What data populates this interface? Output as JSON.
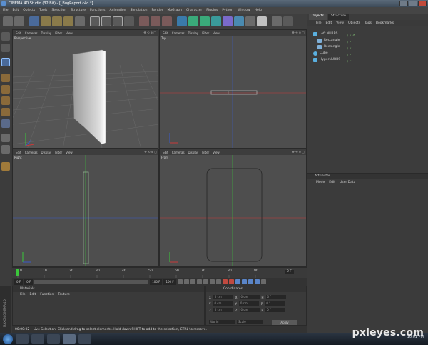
{
  "window": {
    "title": "CINEMA 4D Studio (32 Bit) - [_BugReport.c4d *]"
  },
  "menubar": {
    "items": [
      "File",
      "Edit",
      "Objects",
      "Tools",
      "Selection",
      "Structure",
      "Functions",
      "Animation",
      "Simulation",
      "Render",
      "MoGraph",
      "Character",
      "Plugins",
      "Python",
      "Window",
      "Help"
    ]
  },
  "viewport_menu": {
    "items": [
      "Edit",
      "Cameras",
      "Display",
      "Filter",
      "View"
    ]
  },
  "viewports": {
    "perspective": {
      "label": "Perspective"
    },
    "top": {
      "label": "Top"
    },
    "right": {
      "label": "Right"
    },
    "front": {
      "label": "Front"
    }
  },
  "object_manager": {
    "tabs": [
      "Objects",
      "Structure"
    ],
    "menu": [
      "File",
      "Edit",
      "View",
      "Objects",
      "Tags",
      "Bookmarks"
    ],
    "tree": [
      {
        "name": "Loft NURBS",
        "depth": 0,
        "icon": "loft-icon",
        "color": "#5ab0e0"
      },
      {
        "name": "Rectangle",
        "depth": 1,
        "icon": "spline-icon",
        "color": "#7fb0d8"
      },
      {
        "name": "Rectangle",
        "depth": 1,
        "icon": "spline-icon",
        "color": "#7fb0d8"
      },
      {
        "name": "Cube",
        "depth": 0,
        "icon": "cube-icon",
        "color": "#5ab0e0"
      },
      {
        "name": "HyperNURBS",
        "depth": 0,
        "icon": "hypernurbs-icon",
        "color": "#5ab0e0"
      }
    ]
  },
  "attribute_manager": {
    "title": "Attributes",
    "menu": [
      "Mode",
      "Edit",
      "User Data"
    ]
  },
  "timeline": {
    "ticks": [
      "0",
      "10",
      "20",
      "30",
      "40",
      "50",
      "60",
      "70",
      "80",
      "90"
    ],
    "end_label": "0 F"
  },
  "transport": {
    "start_field": "0 F",
    "current_field": "0 F",
    "end_field": "100 F",
    "end_field2": "100 F"
  },
  "materials": {
    "title": "Materials",
    "menu": [
      "File",
      "Edit",
      "Function",
      "Texture"
    ]
  },
  "coordinates": {
    "title": "Coordinates",
    "rows": [
      {
        "axis": "X",
        "pos": "0 cm",
        "size_axis": "X",
        "size": "0 cm",
        "rot_axis": "H",
        "rot": "0 °"
      },
      {
        "axis": "Y",
        "pos": "0 cm",
        "size_axis": "Y",
        "size": "0 cm",
        "rot_axis": "P",
        "rot": "0 °"
      },
      {
        "axis": "Z",
        "pos": "0 cm",
        "size_axis": "Z",
        "size": "0 cm",
        "rot_axis": "B",
        "rot": "0 °"
      }
    ],
    "mode1": "World",
    "mode2": "Scale",
    "apply": "Apply"
  },
  "status": {
    "time": "00:00:02",
    "message": "Live Selection: Click and drag to select elements. Hold down SHIFT to add to the selection, CTRL to remove."
  },
  "brand": "MAXON CINEMA 4D",
  "watermark": {
    "text": "pxleyes.com"
  },
  "taskbar": {
    "clock": "10:01 PM"
  },
  "colors": {
    "axis_red": "#c83a3a",
    "axis_blue": "#3a5ac8",
    "axis_green": "#3ac83a",
    "accent": "#5ab0e0"
  }
}
